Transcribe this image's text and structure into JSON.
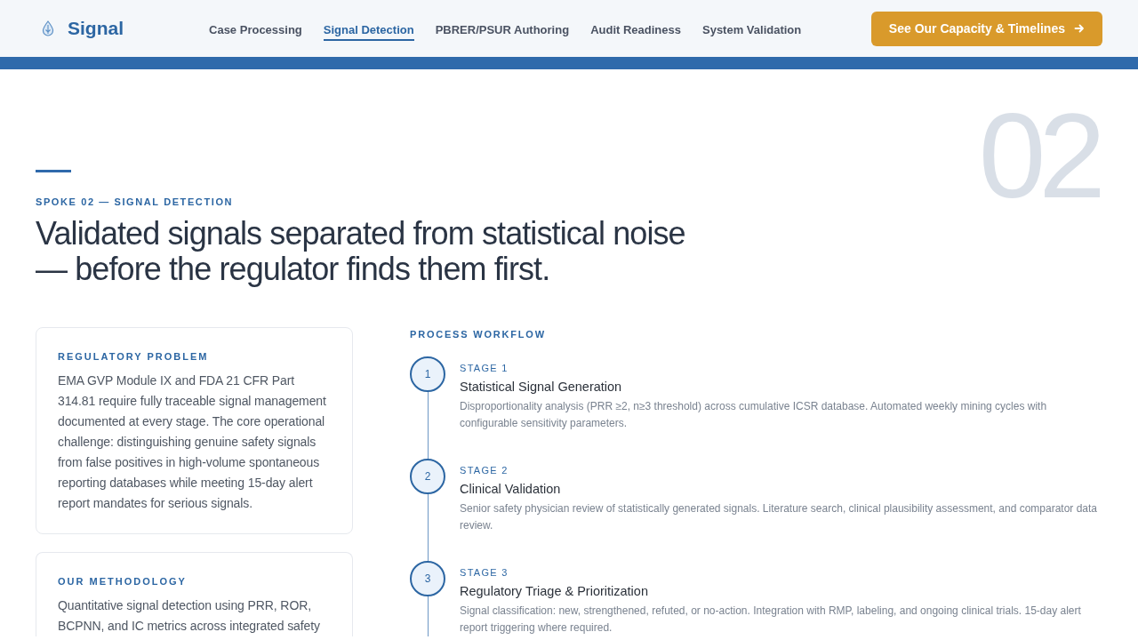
{
  "header": {
    "logo_text": "Signal",
    "nav": [
      {
        "label": "Case Processing",
        "selected": false
      },
      {
        "label": "Signal Detection",
        "selected": true
      },
      {
        "label": "PBRER/PSUR Authoring",
        "selected": false
      },
      {
        "label": "Audit Readiness",
        "selected": false
      },
      {
        "label": "System Validation",
        "selected": false
      }
    ],
    "cta": "See Our Capacity & Timelines"
  },
  "hero": {
    "section_number": "02",
    "eyebrow": "SPOKE 02 — SIGNAL DETECTION",
    "headline": "Validated signals separated from statistical noise — before the regulator finds them first."
  },
  "cards": [
    {
      "title": "REGULATORY PROBLEM",
      "text": "EMA GVP Module IX and FDA 21 CFR Part 314.81 require fully traceable signal management documented at every stage. The core operational challenge: distinguishing genuine safety signals from false positives in high-volume spontaneous reporting databases while meeting 15-day alert report mandates for serious signals."
    },
    {
      "title": "OUR METHODOLOGY",
      "text": "Quantitative signal detection using PRR, ROR, BCPNN, and IC metrics across integrated safety"
    }
  ],
  "workflow": {
    "title": "PROCESS WORKFLOW",
    "stages": [
      {
        "number": "1",
        "label": "STAGE 1",
        "title": "Statistical Signal Generation",
        "description": "Disproportionality analysis (PRR ≥2, n≥3 threshold) across cumulative ICSR database. Automated weekly mining cycles with configurable sensitivity parameters."
      },
      {
        "number": "2",
        "label": "STAGE 2",
        "title": "Clinical Validation",
        "description": "Senior safety physician review of statistically generated signals. Literature search, clinical plausibility assessment, and comparator data review."
      },
      {
        "number": "3",
        "label": "STAGE 3",
        "title": "Regulatory Triage & Prioritization",
        "description": "Signal classification: new, strengthened, refuted, or no-action. Integration with RMP, labeling, and ongoing clinical trials. 15-day alert report triggering where required."
      }
    ]
  }
}
